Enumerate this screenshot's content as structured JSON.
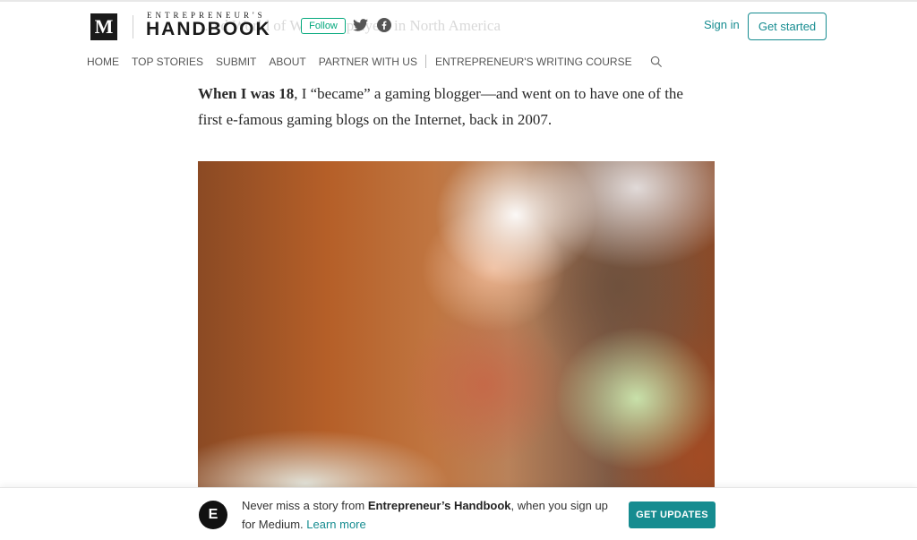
{
  "header": {
    "m_logo": "M",
    "brand_top": "ENTREPRENEUR'S",
    "brand_main": "HANDBOOK",
    "follow_label": "Follow",
    "sign_in": "Sign in",
    "get_started": "Get started",
    "social_icons": [
      "twitter-icon",
      "facebook-icon"
    ]
  },
  "nav": {
    "items": [
      "HOME",
      "TOP STORIES",
      "SUBMIT",
      "ABOUT",
      "PARTNER WITH US"
    ],
    "course": "ENTREPRENEUR'S WRITING COURSE",
    "search_icon": "search-icon"
  },
  "ghost_text": "…ed World of Warcraft players in North America",
  "article": {
    "bold_lead": "When I was 18",
    "text": ", I “became” a gaming blogger—and went on to have one of the first e-famous gaming blogs on the Internet, back in 2007."
  },
  "banner": {
    "badge": "E",
    "text_before": "Never miss a story from ",
    "publication": "Entrepreneur’s Handbook",
    "text_after": ", when you sign up for Medium. ",
    "learn_more": "Learn more",
    "button": "GET UPDATES"
  },
  "colors": {
    "accent": "#168c90",
    "follow": "#03a87c",
    "text": "#292929"
  }
}
